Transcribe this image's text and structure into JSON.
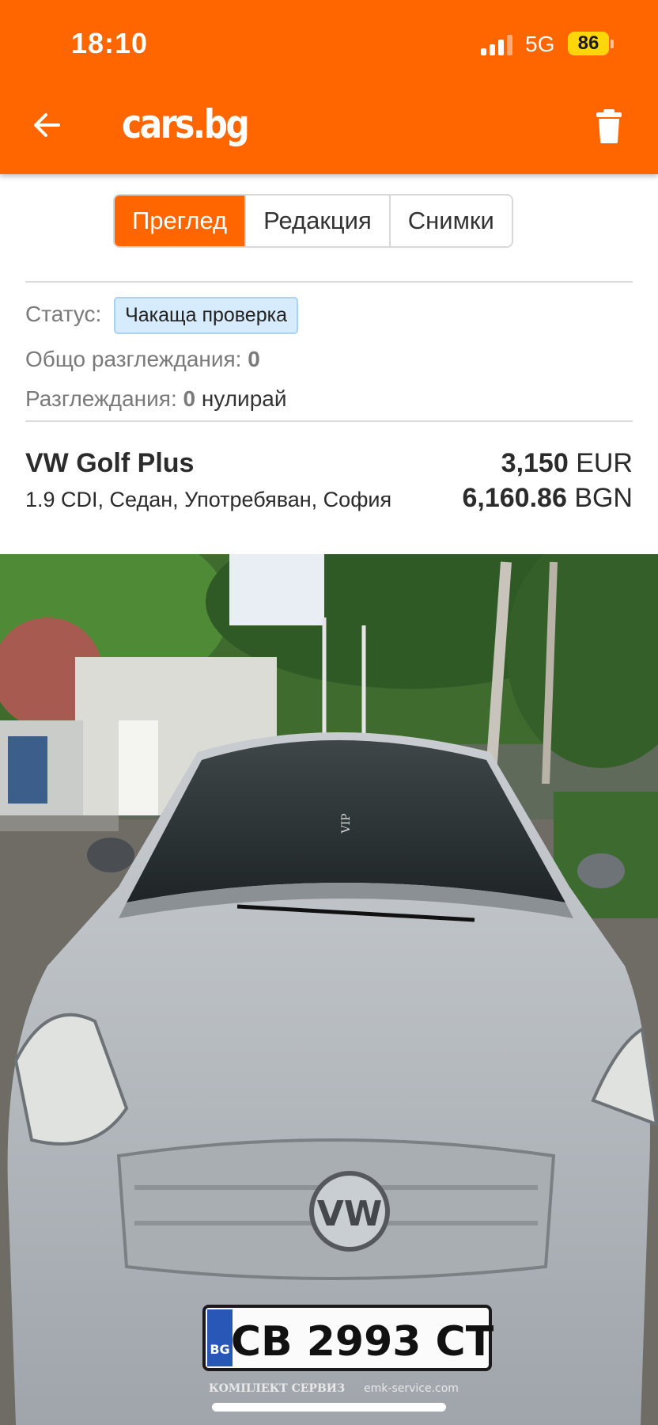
{
  "status_bar": {
    "time": "18:10",
    "network": "5G",
    "battery": "86"
  },
  "header": {
    "logo": "cars.bg",
    "back_icon": "arrow-left-icon",
    "delete_icon": "trash-icon"
  },
  "tabs": [
    {
      "label": "Преглед",
      "active": true
    },
    {
      "label": "Редакция",
      "active": false
    },
    {
      "label": "Снимки",
      "active": false
    }
  ],
  "info": {
    "status_label": "Статус:",
    "status_value": "Чакаща проверка",
    "total_views_label": "Общо разглеждания:",
    "total_views_value": "0",
    "views_label": "Разглеждания:",
    "views_value": "0",
    "reset_link": "нулирай"
  },
  "listing": {
    "title": "VW Golf Plus",
    "details": "1.9 CDI, Седан, Употребяван, София",
    "price_eur": "3,150",
    "currency_eur": "EUR",
    "price_bgn": "6,160.86",
    "currency_bgn": "BGN"
  },
  "photo": {
    "plate_country": "BG",
    "plate_number": "CB 2993 CT",
    "dealer_text": "КОМПЛЕКТ СЕРВИЗ",
    "dealer_url": "emk-service.com",
    "sticker": "VIP"
  },
  "colors": {
    "brand": "#ff6600",
    "badge_bg": "#d6ebfb"
  }
}
